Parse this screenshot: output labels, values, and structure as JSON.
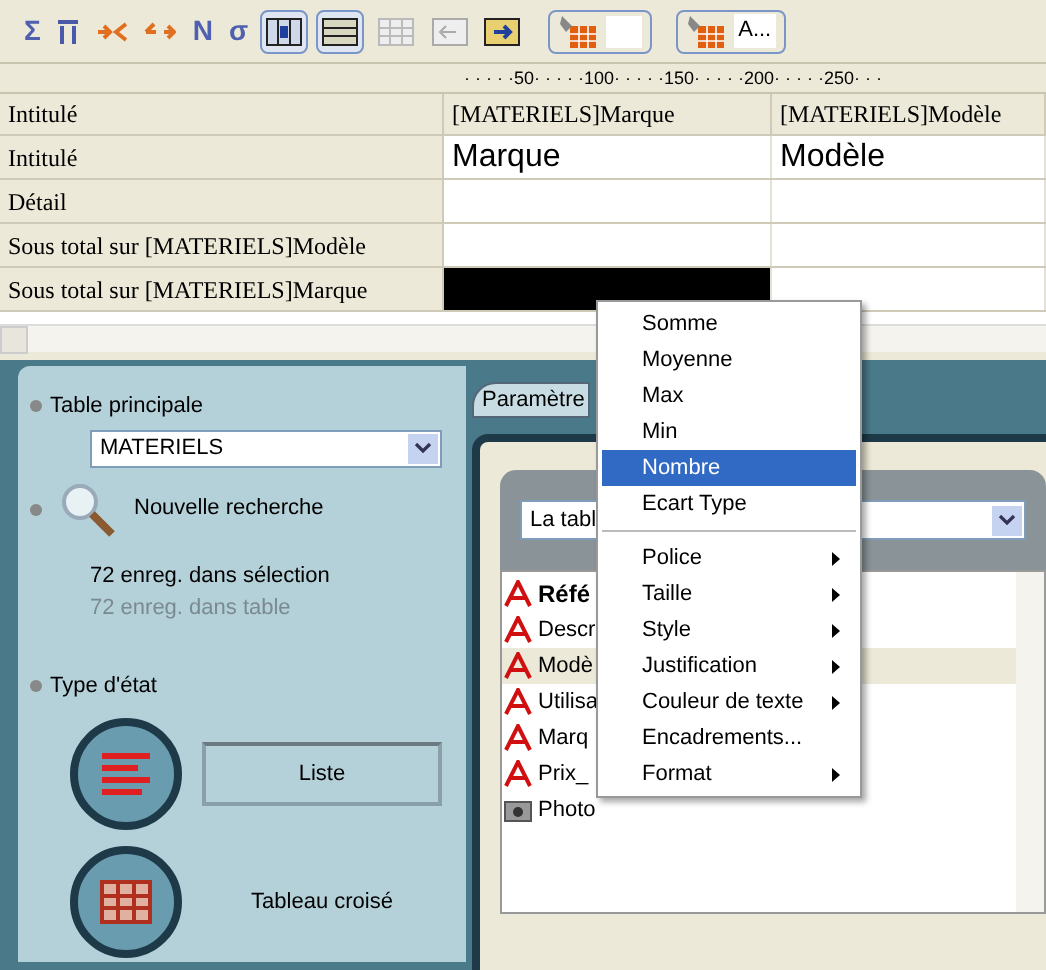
{
  "toolbar": [
    {
      "kind": "glyph",
      "text": "Σ"
    },
    {
      "kind": "icon"
    },
    {
      "kind": "icon"
    },
    {
      "kind": "icon"
    },
    {
      "kind": "glyph",
      "text": "N"
    },
    {
      "kind": "glyph",
      "text": "σ"
    },
    {
      "kind": "toggle",
      "selected": true
    },
    {
      "kind": "toggle",
      "selected": true
    },
    {
      "kind": "toggle",
      "selected": false
    },
    {
      "kind": "icon"
    },
    {
      "kind": "icon"
    },
    {
      "kind": "fill"
    },
    {
      "kind": "fill",
      "text": "A..."
    }
  ],
  "ruler": [
    "· · · · ·50· · · · ·100· · · · ·150· · · · ·200· · · · ·250· · ·"
  ],
  "table": {
    "columns": [
      "Intitulé",
      "[MATERIELS]Marque",
      "[MATERIELS]Modèle"
    ],
    "rows": [
      {
        "kind": "big",
        "cells": [
          "Intitulé",
          "Marque",
          "Modèle"
        ]
      },
      {
        "kind": "plain",
        "cells": [
          "Détail",
          "",
          ""
        ]
      },
      {
        "kind": "plain",
        "cells": [
          "Sous total sur [MATERIELS]Modèle",
          "",
          ""
        ]
      },
      {
        "kind": "selected",
        "cells": [
          "Sous total sur [MATERIELS]Marque",
          "",
          ""
        ]
      }
    ]
  },
  "left_panel": {
    "table_label": "Table principale",
    "table_value": "MATERIELS",
    "search": "Nouvelle recherche",
    "in_selection": "72 enreg. dans sélection",
    "in_table": "72 enreg. dans table",
    "type_label": "Type d'état",
    "types": [
      {
        "kind": "list",
        "label": "Liste",
        "selected": true
      },
      {
        "kind": "cross",
        "label": "Tableau croisé",
        "selected": false
      }
    ]
  },
  "right_panel": {
    "tab": "Paramètre",
    "table_select": "La tabl",
    "fields": [
      {
        "kind": "text",
        "name": "Réfé",
        "bold": true,
        "selected": false
      },
      {
        "kind": "text",
        "name": "Descr",
        "bold": false,
        "selected": false
      },
      {
        "kind": "text",
        "name": "Modè",
        "bold": false,
        "selected": true
      },
      {
        "kind": "text",
        "name": "Utilisa",
        "bold": false,
        "selected": false
      },
      {
        "kind": "text",
        "name": "Marq",
        "bold": false,
        "selected": false
      },
      {
        "kind": "text",
        "name": "Prix_",
        "bold": false,
        "selected": false
      },
      {
        "kind": "photo",
        "name": "Photo",
        "bold": false,
        "selected": false
      }
    ]
  },
  "context_menu": [
    {
      "kind": "item",
      "label": "Somme",
      "selected": false
    },
    {
      "kind": "item",
      "label": "Moyenne",
      "selected": false
    },
    {
      "kind": "item",
      "label": "Max",
      "selected": false
    },
    {
      "kind": "item",
      "label": "Min",
      "selected": false
    },
    {
      "kind": "item",
      "label": "Nombre",
      "selected": true
    },
    {
      "kind": "item",
      "label": "Ecart Type",
      "selected": false
    },
    {
      "kind": "separator"
    },
    {
      "kind": "submenu",
      "label": "Police",
      "selected": false
    },
    {
      "kind": "submenu",
      "label": "Taille",
      "selected": false
    },
    {
      "kind": "submenu",
      "label": "Style",
      "selected": false
    },
    {
      "kind": "submenu",
      "label": "Justification",
      "selected": false
    },
    {
      "kind": "submenu",
      "label": "Couleur de texte",
      "selected": false
    },
    {
      "kind": "item",
      "label": "Encadrements...",
      "selected": false
    },
    {
      "kind": "submenu",
      "label": "Format",
      "selected": false
    }
  ]
}
